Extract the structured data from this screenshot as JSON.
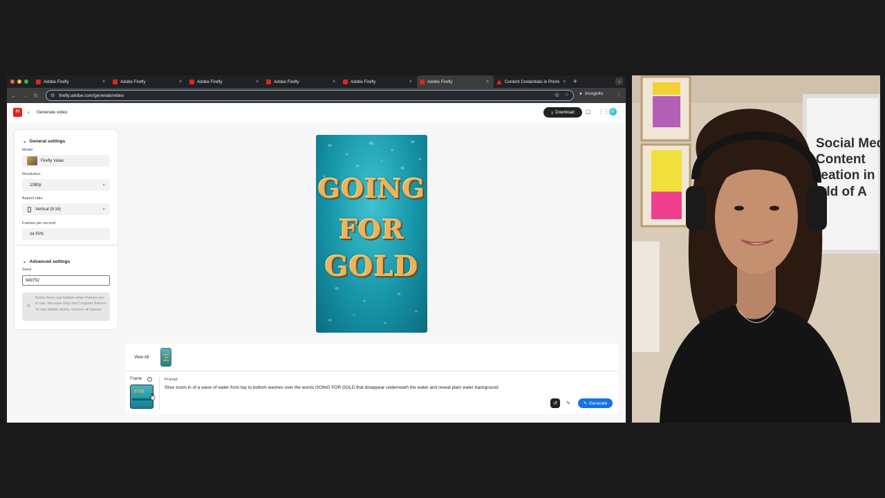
{
  "browser": {
    "tabs": [
      {
        "label": "Adobe Firefly",
        "close": "×",
        "active": false
      },
      {
        "label": "Adobe Firefly",
        "close": "×",
        "active": false
      },
      {
        "label": "Adobe Firefly",
        "close": "×",
        "active": false
      },
      {
        "label": "Adobe Firefly",
        "close": "×",
        "active": false
      },
      {
        "label": "Adobe Firefly",
        "close": "×",
        "active": false
      },
      {
        "label": "Adobe Firefly",
        "close": "×",
        "active": true
      },
      {
        "label": "Content Credentials in Premi",
        "close": "×",
        "active": false
      }
    ],
    "new_tab": "+",
    "url": "firefly.adobe.com/generate/video",
    "incognito_label": "Incognito"
  },
  "app": {
    "logo_text": "Fi",
    "page_title": "Generate video",
    "download_label": "Download"
  },
  "settings": {
    "general_title": "General settings",
    "model_label": "Model",
    "model_value": "Firefly Video",
    "resolution_label": "Resolution",
    "resolution_value": "1080p",
    "aspect_label": "Aspect ratio",
    "aspect_value": "Vertical (9:16)",
    "fps_label": "Frames per second",
    "fps_value": "24 FPS",
    "advanced_title": "Advanced settings",
    "seed_label": "Seed",
    "seed_value": "949752",
    "notice": "Some items are hidden when frames are in use, because they don't support frames. To use hidden items, remove all frames"
  },
  "preview": {
    "line1": "GOING",
    "line2": "FOR",
    "line3": "GOLD"
  },
  "composer": {
    "view_all": "View All",
    "frame_label": "Frame",
    "frame_thumb_text": "FOR",
    "prompt_label": "Prompt",
    "prompt_text": "Slow zoom in of a wave of water from top to bottom washes over the words GOING FOR GOLD that disappear underneath the water and reveal plain water background",
    "generate_label": "Generate"
  },
  "webcam": {
    "sign_lines": [
      "Social Med",
      "Content",
      "reation in",
      "rld of A"
    ]
  },
  "colors": {
    "accent": "#1473e6",
    "brand": "#e1251b",
    "download_bg": "#222222"
  }
}
